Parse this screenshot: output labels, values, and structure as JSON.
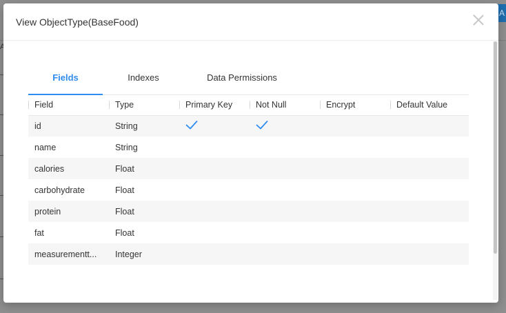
{
  "background": {
    "edge_button_label": "A",
    "edge_letter": "A"
  },
  "modal": {
    "title": "View ObjectType(BaseFood)",
    "close_icon": "close-icon"
  },
  "tabs": [
    {
      "label": "Fields",
      "active": true
    },
    {
      "label": "Indexes",
      "active": false
    },
    {
      "label": "Data Permissions",
      "active": false
    }
  ],
  "table": {
    "columns": [
      "Field",
      "Type",
      "Primary Key",
      "Not Null",
      "Encrypt",
      "Default Value"
    ],
    "rows": [
      {
        "field": "id",
        "type": "String",
        "primary_key": true,
        "not_null": true,
        "encrypt": false,
        "default_value": ""
      },
      {
        "field": "name",
        "type": "String",
        "primary_key": false,
        "not_null": false,
        "encrypt": false,
        "default_value": ""
      },
      {
        "field": "calories",
        "type": "Float",
        "primary_key": false,
        "not_null": false,
        "encrypt": false,
        "default_value": ""
      },
      {
        "field": "carbohydrate",
        "type": "Float",
        "primary_key": false,
        "not_null": false,
        "encrypt": false,
        "default_value": ""
      },
      {
        "field": "protein",
        "type": "Float",
        "primary_key": false,
        "not_null": false,
        "encrypt": false,
        "default_value": ""
      },
      {
        "field": "fat",
        "type": "Float",
        "primary_key": false,
        "not_null": false,
        "encrypt": false,
        "default_value": ""
      },
      {
        "field": "measurementt...",
        "type": "Integer",
        "primary_key": false,
        "not_null": false,
        "encrypt": false,
        "default_value": ""
      }
    ]
  },
  "colors": {
    "accent": "#2d8cf0",
    "check": "#2d8cf0"
  }
}
